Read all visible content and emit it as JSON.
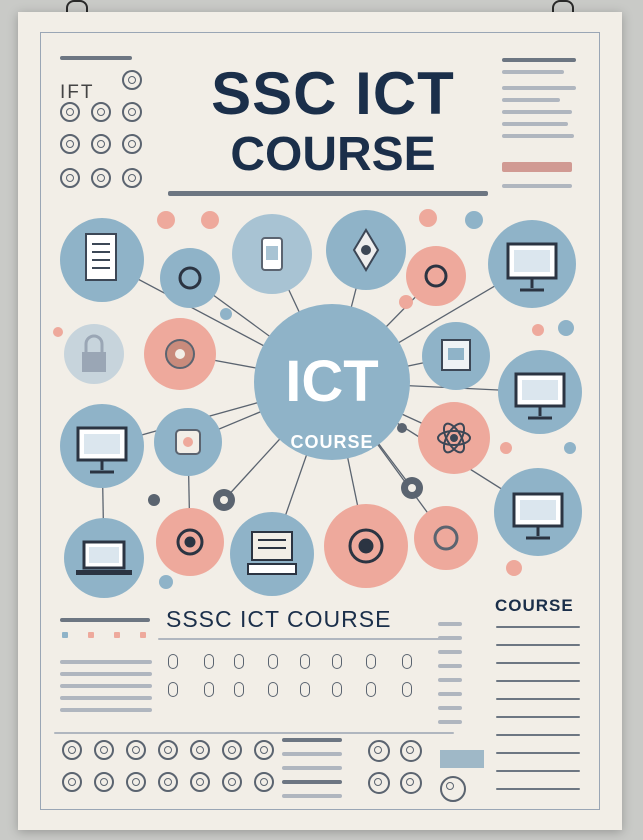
{
  "poster": {
    "title_line1": "SSC ICT",
    "title_line2": "COURSE",
    "center_label_1": "ICT",
    "center_label_2": "COURSE",
    "subtitle": "SSSC ICT COURSE",
    "side_heading": "COURSE",
    "left_badge": "IFT",
    "colors": {
      "navy": "#1b2f4a",
      "blue": "#8fb3c8",
      "pink": "#eea99c",
      "cream": "#f2eee7",
      "line": "#5b6470"
    },
    "icons": [
      "document-icon",
      "monitor-icon",
      "laptop-icon",
      "atom-icon",
      "keyboard-icon",
      "eye-icon",
      "phone-icon",
      "target-icon"
    ]
  }
}
